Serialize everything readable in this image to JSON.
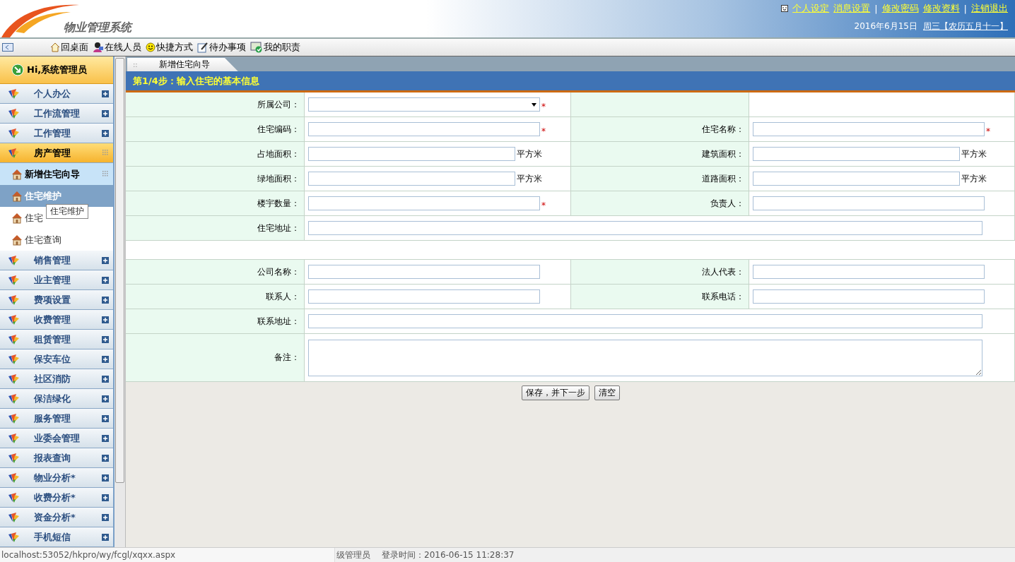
{
  "header": {
    "system_title": "物业管理系统",
    "links": [
      {
        "kind": "link",
        "label": "个人设定",
        "icon": true
      },
      {
        "kind": "link",
        "label": "消息设置"
      },
      {
        "kind": "separator",
        "label": "|"
      },
      {
        "kind": "link",
        "label": "修改密码"
      },
      {
        "kind": "link",
        "label": "修改资料"
      },
      {
        "kind": "separator",
        "label": "|"
      },
      {
        "kind": "link",
        "label": "注销退出"
      }
    ],
    "date": "2016年6月15日",
    "weekday_link": "周三【农历五月十一】"
  },
  "toolbar": {
    "items": [
      {
        "label": "回桌面"
      },
      {
        "label": "在线人员"
      },
      {
        "label": "快捷方式"
      },
      {
        "label": "待办事项"
      },
      {
        "label": "我的职责"
      }
    ]
  },
  "sidebar": {
    "greeting": "Hi,系统管理员",
    "items": [
      {
        "label": "个人办公",
        "expanded": false
      },
      {
        "label": "工作流管理",
        "expanded": false
      },
      {
        "label": "工作管理",
        "expanded": false
      },
      {
        "label": "房产管理",
        "expanded": true,
        "children": [
          {
            "label": "新增住宅向导",
            "selected": true,
            "hovered": false
          },
          {
            "label": "住宅维护",
            "selected": false,
            "hovered": true,
            "tooltip": "住宅维护"
          },
          {
            "label": "住宅",
            "selected": false,
            "hovered": false
          },
          {
            "label": "住宅查询",
            "selected": false,
            "hovered": false
          }
        ]
      },
      {
        "label": "销售管理",
        "expanded": false
      },
      {
        "label": "业主管理",
        "expanded": false
      },
      {
        "label": "费项设置",
        "expanded": false
      },
      {
        "label": "收费管理",
        "expanded": false
      },
      {
        "label": "租赁管理",
        "expanded": false
      },
      {
        "label": "保安车位",
        "expanded": false
      },
      {
        "label": "社区消防",
        "expanded": false
      },
      {
        "label": "保洁绿化",
        "expanded": false
      },
      {
        "label": "服务管理",
        "expanded": false
      },
      {
        "label": "业委会管理",
        "expanded": false
      },
      {
        "label": "报表查询",
        "expanded": false
      },
      {
        "label": "物业分析*",
        "expanded": false
      },
      {
        "label": "收费分析*",
        "expanded": false
      },
      {
        "label": "资金分析*",
        "expanded": false
      },
      {
        "label": "手机短信",
        "expanded": false
      }
    ]
  },
  "tabs": [
    {
      "grip": "::",
      "label": "新增住宅向导",
      "selected": true
    }
  ],
  "step_title": "第1/4步：输入住宅的基本信息",
  "form": {
    "sections": [
      {
        "rows": [
          {
            "fields": [
              {
                "label": "所属公司：",
                "kind": "select",
                "required_mark": "*"
              }
            ]
          },
          {
            "fields": [
              {
                "label": "住宅编码：",
                "kind": "text",
                "required_mark": "*"
              },
              {
                "label": "住宅名称：",
                "kind": "text",
                "required_mark": "*"
              }
            ]
          },
          {
            "fields": [
              {
                "label": "占地面积：",
                "kind": "text",
                "unit": "平方米"
              },
              {
                "label": "建筑面积：",
                "kind": "text",
                "unit": "平方米"
              }
            ]
          },
          {
            "fields": [
              {
                "label": "绿地面积：",
                "kind": "text",
                "unit": "平方米"
              },
              {
                "label": "道路面积：",
                "kind": "text",
                "unit": "平方米"
              }
            ]
          },
          {
            "fields": [
              {
                "label": "楼宇数量：",
                "kind": "text",
                "required_mark": "*"
              },
              {
                "label": "负责人：",
                "kind": "text"
              }
            ]
          },
          {
            "fields": [
              {
                "label": "住宅地址：",
                "kind": "text",
                "wide": true
              }
            ]
          }
        ]
      },
      {
        "rows": [
          {
            "fields": [
              {
                "label": "公司名称：",
                "kind": "text"
              },
              {
                "label": "法人代表：",
                "kind": "text"
              }
            ]
          },
          {
            "fields": [
              {
                "label": "联系人：",
                "kind": "text"
              },
              {
                "label": "联系电话：",
                "kind": "text"
              }
            ]
          },
          {
            "fields": [
              {
                "label": "联系地址：",
                "kind": "text",
                "wide": true
              }
            ]
          },
          {
            "fields": [
              {
                "label": "备注：",
                "kind": "textarea",
                "wide": true
              }
            ]
          }
        ]
      }
    ],
    "buttons": [
      "保存，并下一步",
      "清空"
    ]
  },
  "status_bar": {
    "url": "localhost:53052/hkpro/wy/fcgl/xqxx.aspx",
    "user": "级管理员",
    "login_time": "登录时间：2016-06-15 11:28:37"
  }
}
